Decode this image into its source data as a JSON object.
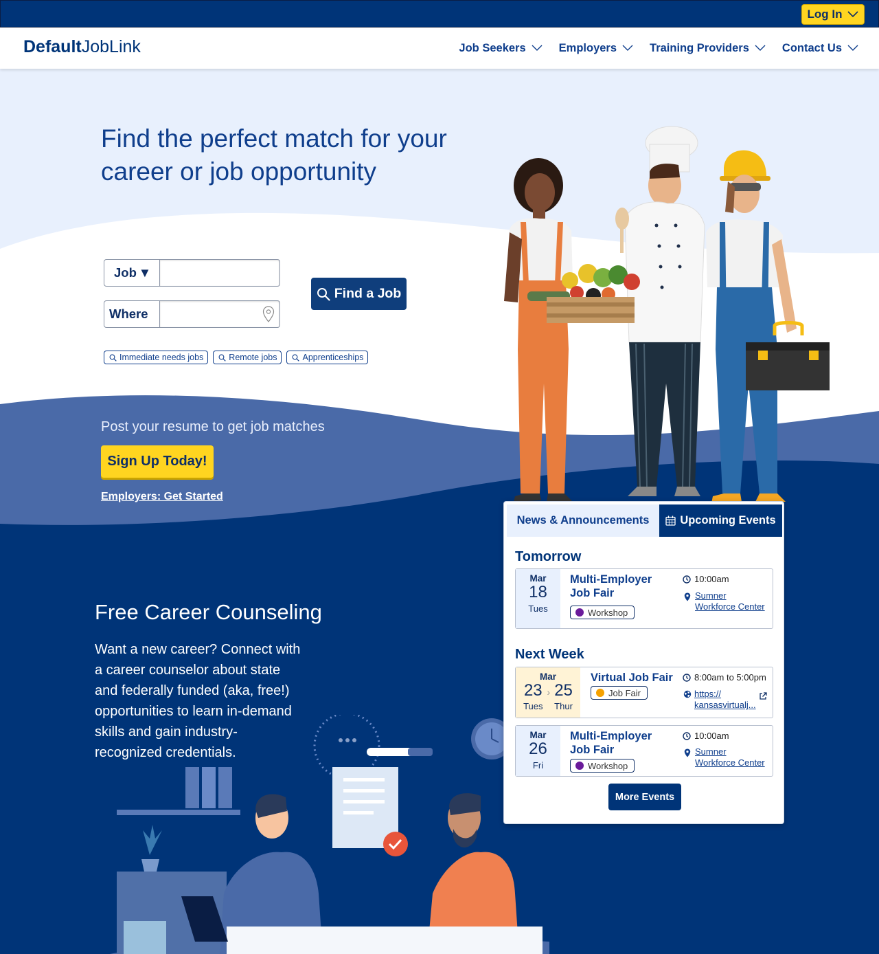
{
  "topbar": {
    "login_label": "Log In"
  },
  "header": {
    "logo_bold": "Default",
    "logo_light": "JobLink",
    "nav": [
      {
        "label": "Job Seekers"
      },
      {
        "label": "Employers"
      },
      {
        "label": "Training Providers"
      },
      {
        "label": "Contact Us"
      }
    ]
  },
  "hero": {
    "title": "Find the perfect match for your career or job opportunity",
    "search": {
      "type_selected": "Job",
      "where_label": "Where",
      "job_value": "",
      "where_value": "",
      "find_label": "Find a Job"
    },
    "chips": [
      "Immediate needs jobs",
      "Remote jobs",
      "Apprenticeships"
    ],
    "post_resume": "Post your resume to get job matches",
    "signup_label": "Sign Up Today!",
    "employers_link": "Employers: Get Started"
  },
  "counseling": {
    "title": "Free Career Counseling",
    "body": "Want a new career? Connect with a career counselor about state and federally funded (aka, free!) opportunities to learn in-demand skills and gain industry-recognized credentials."
  },
  "events": {
    "tabs": {
      "news": "News & Announcements",
      "upcoming": "Upcoming Events"
    },
    "groups": [
      {
        "heading": "Tomorrow",
        "items": [
          {
            "month": "Mar",
            "day": "18",
            "weekday": "Tues",
            "title_line1": "Multi-Employer",
            "title_line2": "Job Fair",
            "tag": "Workshop",
            "tag_color": "#6a1b9a",
            "time": "10:00am",
            "loc_line1": "Sumner",
            "loc_line2": "Workforce Center"
          }
        ]
      },
      {
        "heading": "Next Week",
        "items": [
          {
            "month": "Mar",
            "day_start": "23",
            "weekday_start": "Tues",
            "day_end": "25",
            "weekday_end": "Thur",
            "title_line1": "Virtual Job Fair",
            "tag": "Job Fair",
            "tag_color": "#f5a100",
            "time": "8:00am to 5:00pm",
            "loc_line1": "https://",
            "loc_line2": "kansasvirtualj..."
          },
          {
            "month": "Mar",
            "day": "26",
            "weekday": "Fri",
            "title_line1": "Multi-Employer",
            "title_line2": "Job Fair",
            "tag": "Workshop",
            "tag_color": "#6a1b9a",
            "time": "10:00am",
            "loc_line1": "Sumner",
            "loc_line2": "Workforce Center"
          }
        ]
      }
    ],
    "more_label": "More Events"
  },
  "colors": {
    "navy": "#003478",
    "accent": "#ffd520",
    "hero_light": "#e8f0fd",
    "mid_blue": "#4a6aa8"
  }
}
